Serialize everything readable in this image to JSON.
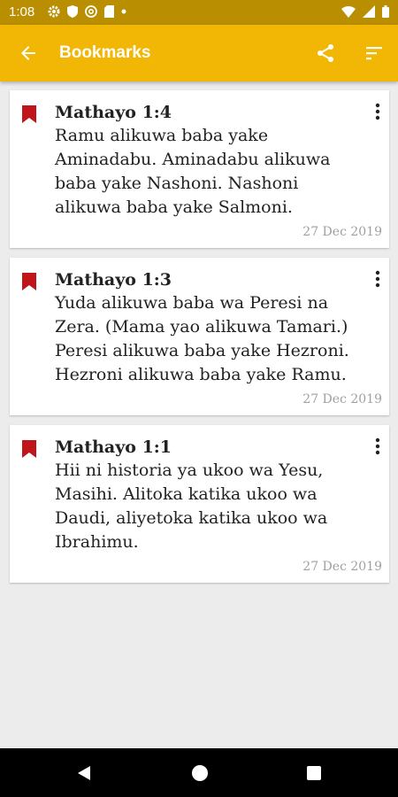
{
  "status_bar": {
    "time": "1:08",
    "icons": [
      "gear-icon",
      "shield-icon",
      "at-icon",
      "sd-card-icon",
      "dot-icon",
      "wifi-icon",
      "signal-icon",
      "battery-icon"
    ]
  },
  "app_bar": {
    "title": "Bookmarks",
    "background": "#f2b705",
    "actions": [
      "back-arrow-icon",
      "share-icon",
      "sort-icon"
    ]
  },
  "bookmarks": [
    {
      "ref": "Mathayo 1:4",
      "text": "Ramu alikuwa baba yake Aminadabu. Aminadabu alikuwa baba yake Nashoni. Nashoni alikuwa baba yake Salmoni.",
      "date": "27 Dec 2019"
    },
    {
      "ref": "Mathayo 1:3",
      "text": "Yuda alikuwa baba wa Peresi na Zera. (Mama yao alikuwa Tamari.) Peresi alikuwa baba yake Hezroni. Hezroni alikuwa baba yake Ramu.",
      "date": "27 Dec 2019"
    },
    {
      "ref": "Mathayo 1:1",
      "text": "Hii ni historia ya ukoo wa Yesu, Masihi. Alitoka katika ukoo wa Daudi, aliyetoka katika ukoo wa Ibrahimu.",
      "date": "27 Dec 2019"
    }
  ],
  "colors": {
    "accent": "#f2b705",
    "bookmark": "#c0161b",
    "status_bar": "#b98e00"
  }
}
